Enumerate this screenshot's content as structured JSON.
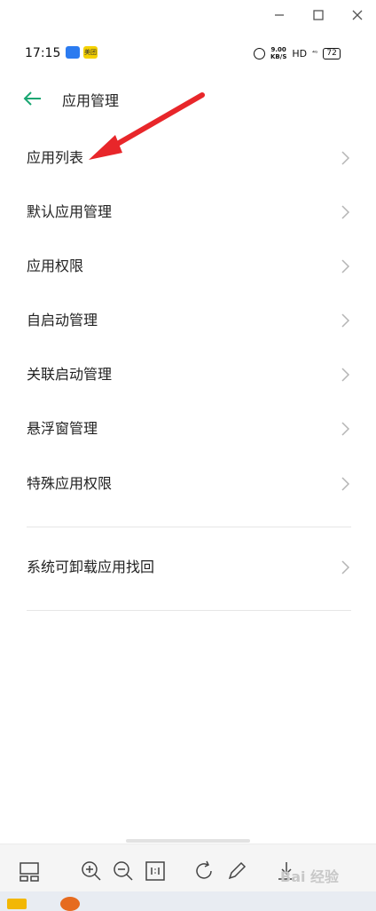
{
  "status_bar": {
    "time": "17:15",
    "badge_text": "美团",
    "net_speed_top": "9.00",
    "net_speed_unit": "KB/S",
    "hd": "HD",
    "network": "⁴ᴳ",
    "battery": "72"
  },
  "header": {
    "title": "应用管理"
  },
  "menu": {
    "items": [
      {
        "label": "应用列表"
      },
      {
        "label": "默认应用管理"
      },
      {
        "label": "应用权限"
      },
      {
        "label": "自启动管理"
      },
      {
        "label": "关联启动管理"
      },
      {
        "label": "悬浮窗管理"
      },
      {
        "label": "特殊应用权限"
      }
    ],
    "extra_item": {
      "label": "系统可卸载应用找回"
    }
  },
  "watermark": "Bai 经验",
  "colors": {
    "accent": "#1aa672",
    "annotation": "#e8262a"
  },
  "icons": {
    "back": "arrow-left-icon",
    "chevron": "chevron-right-icon"
  }
}
